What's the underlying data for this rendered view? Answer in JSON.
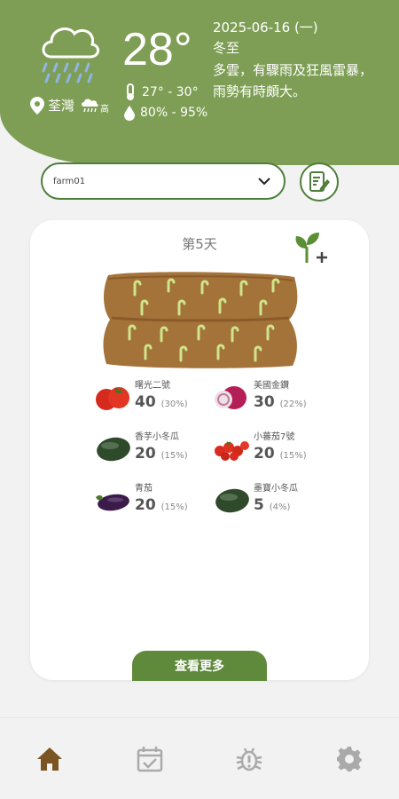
{
  "weather": {
    "location": "荃灣",
    "level": "高",
    "temperature": "28°",
    "temp_range": "27° - 30°",
    "humidity": "80% - 95%",
    "date": "2025-06-16 (一)",
    "solar_term": "冬至",
    "forecast": "多雲，有驟雨及狂風雷暴，雨勢有時頗大。",
    "icon": "rain-cloud-icon"
  },
  "farm": {
    "selected": "farm01"
  },
  "card": {
    "day": "第5天",
    "more_label": "查看更多",
    "crops": [
      {
        "name": "曙光二號",
        "count": "40",
        "percent": "(30%)",
        "icon": "tomato-icon"
      },
      {
        "name": "美國金鑽",
        "count": "30",
        "percent": "(22%)",
        "icon": "onion-icon"
      },
      {
        "name": "香芋小冬瓜",
        "count": "20",
        "percent": "(15%)",
        "icon": "wax-gourd-icon"
      },
      {
        "name": "小蕃茄7號",
        "count": "20",
        "percent": "(15%)",
        "icon": "cherry-tomato-icon"
      },
      {
        "name": "青茄",
        "count": "20",
        "percent": "(15%)",
        "icon": "eggplant-icon"
      },
      {
        "name": "墨寶小冬瓜",
        "count": "5",
        "percent": "(4%)",
        "icon": "wax-gourd-icon"
      }
    ]
  },
  "colors": {
    "header": "#7e9e55",
    "accent": "#5f8a3c",
    "brown": "#8b5a2b"
  },
  "nav": [
    "home-icon",
    "calendar-check-icon",
    "bug-icon",
    "settings-gear-icon"
  ]
}
